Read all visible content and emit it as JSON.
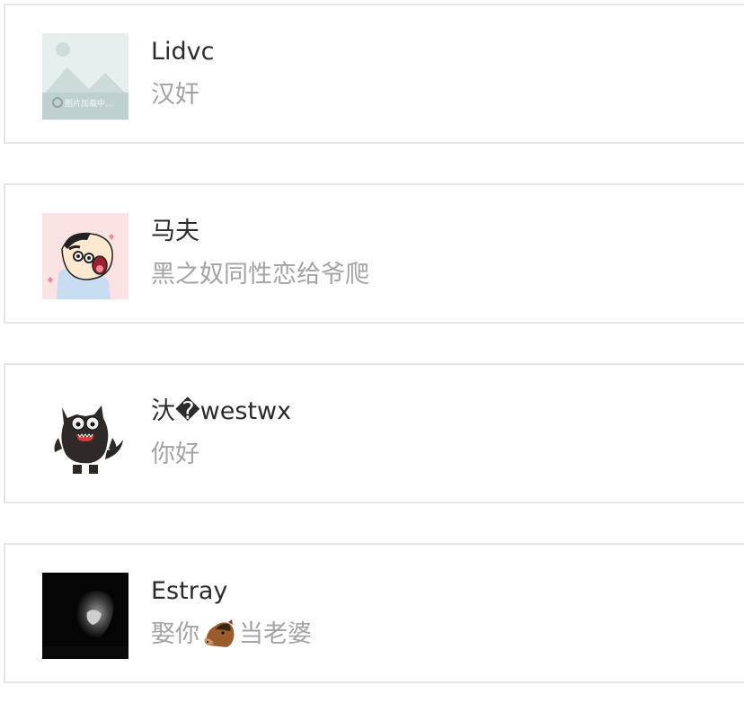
{
  "conversations": [
    {
      "name": "Lidvc",
      "message": "汉奸",
      "avatar_icon": "image-loading-placeholder-icon",
      "avatar_caption": "图片加载中..."
    },
    {
      "name": "马夫",
      "message": "黑之奴同性恋给爷爬",
      "avatar_icon": "cartoon-boy-avatar-icon"
    },
    {
      "name": "汏�westwx",
      "message": "你好",
      "avatar_icon": "black-monster-avatar-icon"
    },
    {
      "name": "Estray",
      "message_before": "娶你",
      "message_emoji": "horse-face-emoji",
      "message_after": "当老婆",
      "avatar_icon": "dark-photo-avatar-icon"
    }
  ],
  "colors": {
    "name_text": "#2b2b2b",
    "message_text": "#a3a3a3",
    "card_border": "#e6e6e6",
    "background": "#ffffff"
  }
}
